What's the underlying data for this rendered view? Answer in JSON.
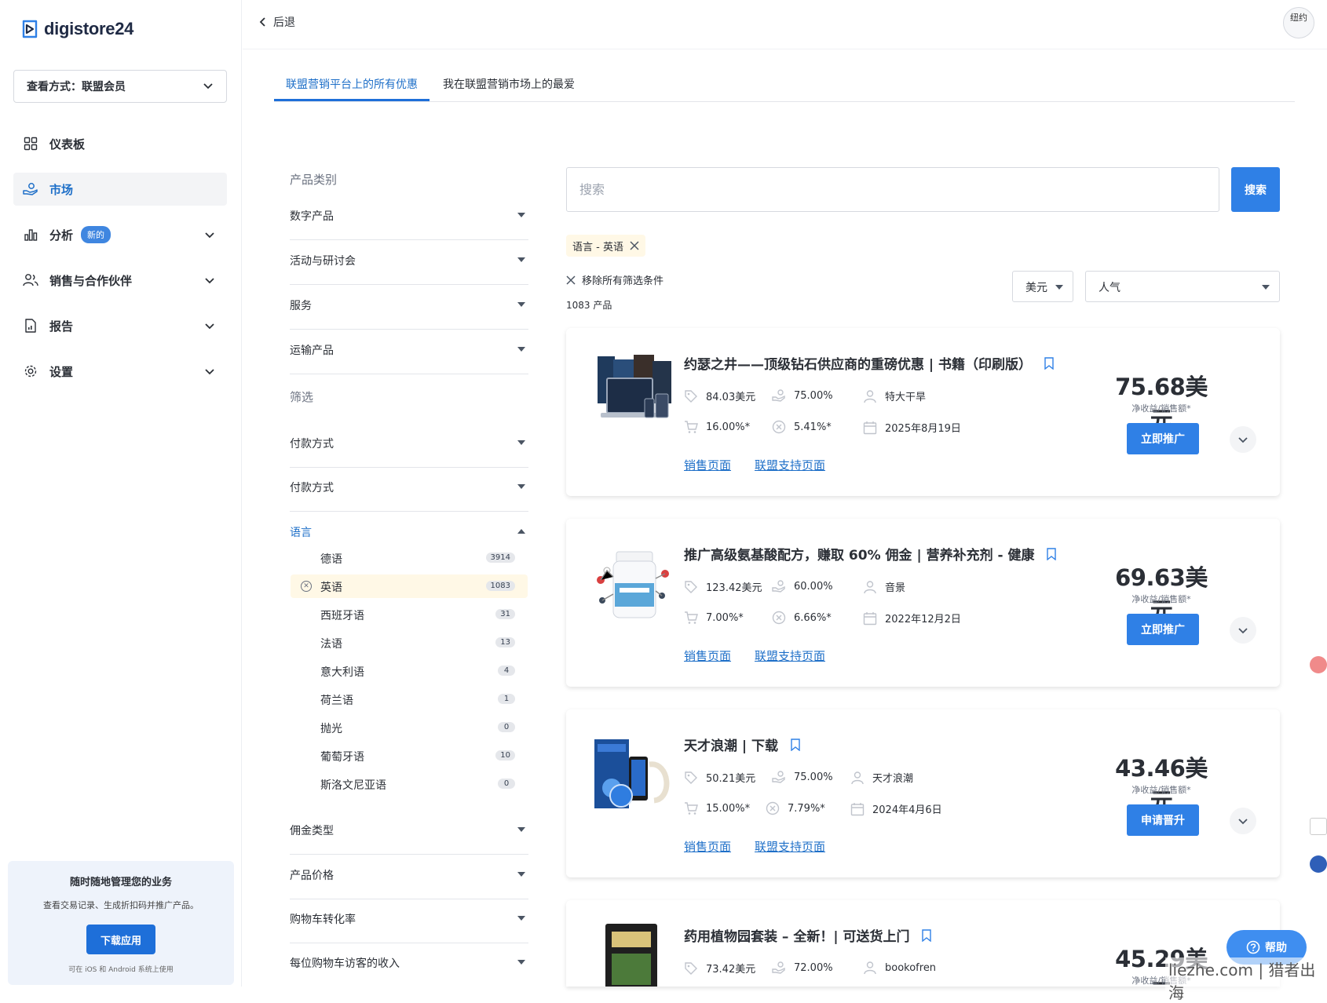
{
  "app": {
    "logo_text": "digistore24"
  },
  "sidebar": {
    "view_select": "查看方式：联盟会员",
    "items": [
      {
        "label": "仪表板"
      },
      {
        "label": "市场"
      },
      {
        "label": "分析",
        "badge": "新的"
      },
      {
        "label": "销售与合作伙伴"
      },
      {
        "label": "报告"
      },
      {
        "label": "设置"
      }
    ],
    "promo": {
      "title": "随时随地管理您的业务",
      "text": "查看交易记录、生成折扣码并推广产品。",
      "button": "下载应用",
      "note": "可在 iOS 和 Android 系统上使用"
    }
  },
  "topbar": {
    "back_label": "后退",
    "user_label": "纽约"
  },
  "tabs": [
    {
      "label": "联盟营销平台上的所有优惠",
      "active": true
    },
    {
      "label": "我在联盟营销市场上的最爱",
      "active": false
    }
  ],
  "filters": {
    "category_heading": "产品类别",
    "categories": [
      "数字产品",
      "活动与研讨会",
      "服务",
      "运输产品"
    ],
    "filter_heading": "筛选",
    "payment_rows": [
      "付款方式",
      "付款方式"
    ],
    "language_label": "语言",
    "languages": [
      {
        "name": "德语",
        "count": "3914"
      },
      {
        "name": "英语",
        "count": "1083",
        "selected": true
      },
      {
        "name": "西班牙语",
        "count": "31"
      },
      {
        "name": "法语",
        "count": "13"
      },
      {
        "name": "意大利语",
        "count": "4"
      },
      {
        "name": "荷兰语",
        "count": "1"
      },
      {
        "name": "抛光",
        "count": "0"
      },
      {
        "name": "葡萄牙语",
        "count": "10"
      },
      {
        "name": "斯洛文尼亚语",
        "count": "0"
      }
    ],
    "more": [
      "佣金类型",
      "产品价格",
      "购物车转化率",
      "每位购物车访客的收入"
    ]
  },
  "search": {
    "placeholder": "搜索",
    "button": "搜索"
  },
  "active_filter": {
    "label": "语言 - 英语"
  },
  "clear_all": "移除所有筛选条件",
  "product_count": "1083 产品",
  "currency_select": "美元",
  "sort_select": "人气",
  "products": [
    {
      "title": "约瑟之井——顶级钻石供应商的重磅优惠 | 书籍（印刷版）",
      "price": "84.03美元",
      "commission": "75.00%",
      "vendor": "特大干旱",
      "cart_conv": "16.00%*",
      "cancel_rate": "5.41%*",
      "date": "2025年8月19日",
      "sales_link": "销售页面",
      "support_link": "联盟支持页面",
      "earnings": "75.68美元",
      "earnings_label": "净收益/销售额*",
      "button": "立即推广"
    },
    {
      "title": "推广高级氨基酸配方，赚取 60% 佣金 | 营养补充剂 - 健康",
      "price": "123.42美元",
      "commission": "60.00%",
      "vendor": "音景",
      "cart_conv": "7.00%*",
      "cancel_rate": "6.66%*",
      "date": "2022年12月2日",
      "sales_link": "销售页面",
      "support_link": "联盟支持页面",
      "earnings": "69.63美元",
      "earnings_label": "净收益/销售额*",
      "button": "立即推广"
    },
    {
      "title": "天才浪潮 | 下载",
      "price": "50.21美元",
      "commission": "75.00%",
      "vendor": "天才浪潮",
      "cart_conv": "15.00%*",
      "cancel_rate": "7.79%*",
      "date": "2024年4月6日",
      "sales_link": "销售页面",
      "support_link": "联盟支持页面",
      "earnings": "43.46美元",
      "earnings_label": "净收益/销售额*",
      "button": "申请晋升"
    },
    {
      "title": "药用植物园套装 – 全新！| 可送货上门",
      "price": "73.42美元",
      "commission": "72.00%",
      "vendor": "bookofren",
      "earnings": "45.29美元",
      "earnings_label": "净收益/销售额*"
    }
  ],
  "help_button": "帮助",
  "watermark": "liezhe.com | 猎者出海",
  "colors": {
    "accent": "#1e6fd9",
    "link": "#1e6fc8",
    "chip_bg": "#fff8e6"
  }
}
